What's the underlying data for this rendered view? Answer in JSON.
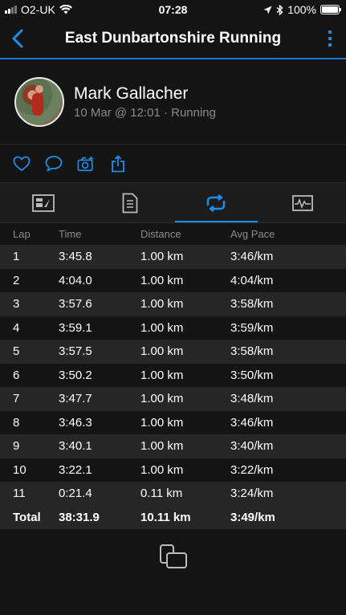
{
  "status_bar": {
    "carrier": "O2-UK",
    "time": "07:28",
    "battery": "100%"
  },
  "nav": {
    "title": "East Dunbartonshire Running"
  },
  "activity": {
    "user_name": "Mark Gallacher",
    "subtitle": "10 Mar @ 12:01 · Running"
  },
  "laps": {
    "headers": {
      "lap": "Lap",
      "time": "Time",
      "distance": "Distance",
      "avg_pace": "Avg Pace"
    },
    "rows": [
      {
        "lap": "1",
        "time": "3:45.8",
        "distance": "1.00 km",
        "avg_pace": "3:46/km"
      },
      {
        "lap": "2",
        "time": "4:04.0",
        "distance": "1.00 km",
        "avg_pace": "4:04/km"
      },
      {
        "lap": "3",
        "time": "3:57.6",
        "distance": "1.00 km",
        "avg_pace": "3:58/km"
      },
      {
        "lap": "4",
        "time": "3:59.1",
        "distance": "1.00 km",
        "avg_pace": "3:59/km"
      },
      {
        "lap": "5",
        "time": "3:57.5",
        "distance": "1.00 km",
        "avg_pace": "3:58/km"
      },
      {
        "lap": "6",
        "time": "3:50.2",
        "distance": "1.00 km",
        "avg_pace": "3:50/km"
      },
      {
        "lap": "7",
        "time": "3:47.7",
        "distance": "1.00 km",
        "avg_pace": "3:48/km"
      },
      {
        "lap": "8",
        "time": "3:46.3",
        "distance": "1.00 km",
        "avg_pace": "3:46/km"
      },
      {
        "lap": "9",
        "time": "3:40.1",
        "distance": "1.00 km",
        "avg_pace": "3:40/km"
      },
      {
        "lap": "10",
        "time": "3:22.1",
        "distance": "1.00 km",
        "avg_pace": "3:22/km"
      },
      {
        "lap": "11",
        "time": "0:21.4",
        "distance": "0.11 km",
        "avg_pace": "3:24/km"
      }
    ],
    "total": {
      "lap": "Total",
      "time": "38:31.9",
      "distance": "10.11 km",
      "avg_pace": "3:49/km"
    }
  },
  "icons": {
    "back": "chevron-left-icon",
    "more": "more-vertical-icon",
    "like": "heart-icon",
    "comment": "comment-icon",
    "photo": "camera-add-icon",
    "share": "share-icon",
    "tab_stats": "stats-chart-icon",
    "tab_details": "document-icon",
    "tab_laps": "laps-loop-icon",
    "tab_graph": "activity-graph-icon",
    "bottom": "copy-icon"
  },
  "colors": {
    "accent": "#1e8fe8",
    "background": "#141414",
    "row_alt": "#262626",
    "muted_text": "#8a8a8a"
  }
}
